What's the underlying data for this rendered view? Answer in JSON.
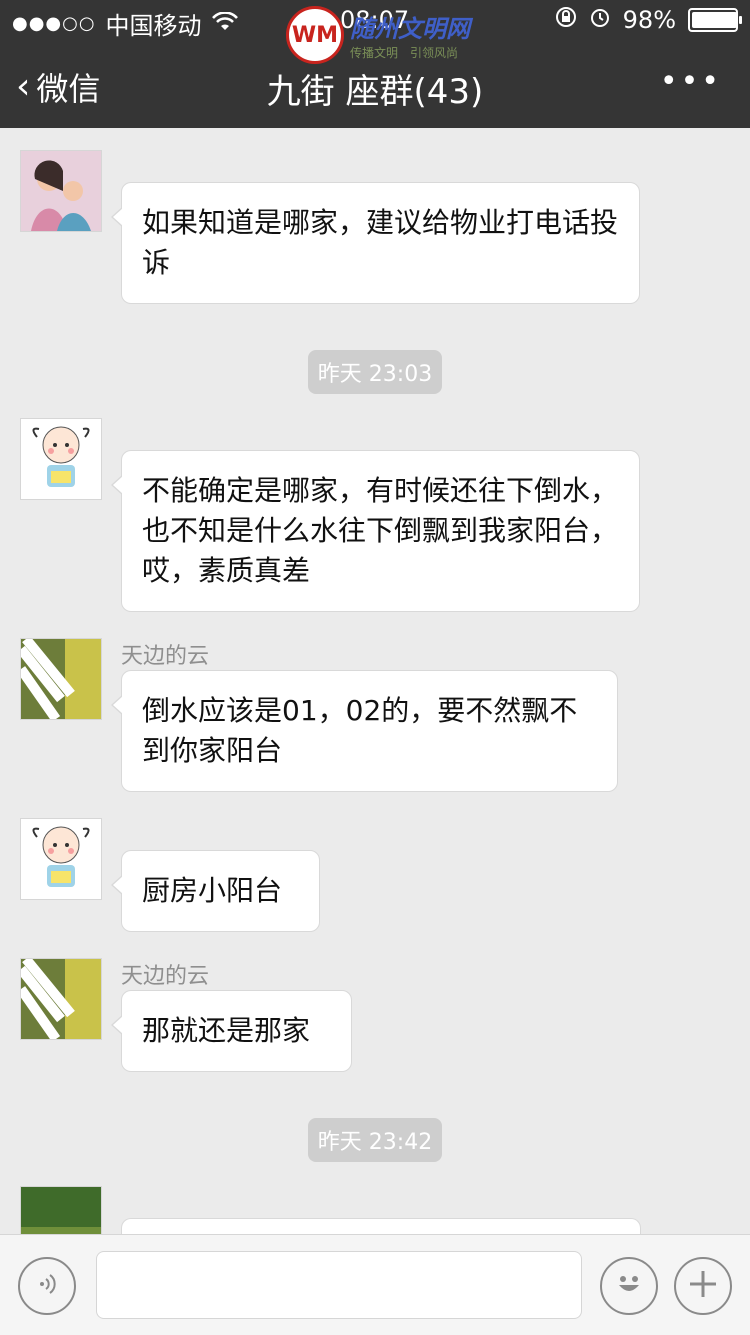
{
  "status_bar": {
    "signal": "●●●○○",
    "carrier": "中国移动",
    "time": "08:07",
    "battery": "98%",
    "battery_level": 0.98
  },
  "watermark": {
    "logo_text": "WM",
    "title": "随州文明网",
    "subtitle": "传播文明　引领风尚"
  },
  "nav": {
    "back_label": "微信",
    "title": "九街 座群(43)",
    "more_label": "•••"
  },
  "messages": [
    {
      "sender": "",
      "text": "如果知道是哪家，建议给物业打电话投诉"
    },
    {
      "timestamp": "昨天 23:03"
    },
    {
      "sender": "",
      "text": "不能确定是哪家，有时候还往下倒水，也不知是什么水往下倒飘到我家阳台，哎，素质真差"
    },
    {
      "sender": "天边的云",
      "text": "倒水应该是01，02的，要不然飘不到你家阳台"
    },
    {
      "sender": "",
      "text": "厨房小阳台"
    },
    {
      "sender": "天边的云",
      "text": "那就还是那家"
    },
    {
      "timestamp": "昨天 23:42"
    },
    {
      "sender": "",
      "text": ""
    }
  ],
  "input_bar": {
    "voice_icon": "voice-icon",
    "emoji_icon": "emoji-icon",
    "add_icon": "plus-icon"
  }
}
